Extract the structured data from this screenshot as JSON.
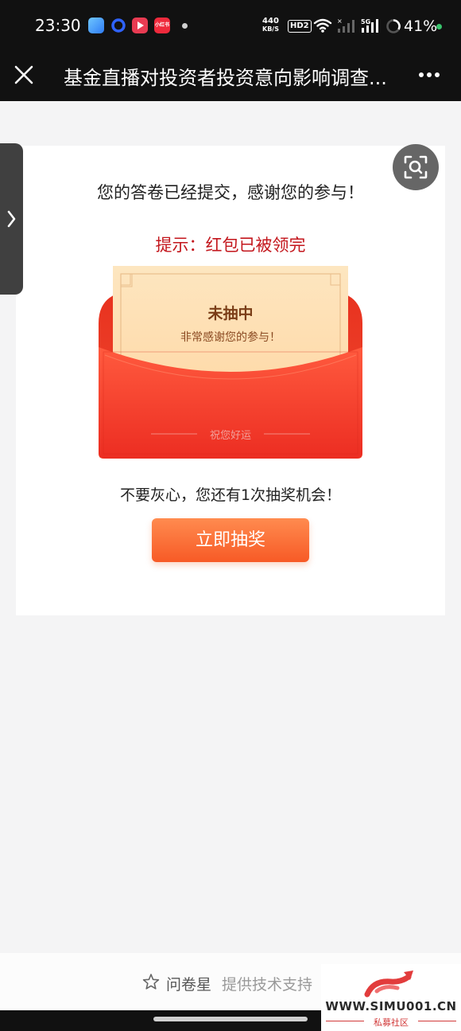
{
  "status_bar": {
    "time": "23:30",
    "net_speed_value": "440",
    "net_speed_unit": "KB/S",
    "hd_badge": "HD2",
    "network_type": "5G",
    "battery": "41%",
    "app_icons": [
      "notes-app-icon",
      "browser-app-icon",
      "video-app-icon",
      "xiaohongshu-app-icon"
    ],
    "xiaohongshu_label": "小红书"
  },
  "title_bar": {
    "title": "基金直播对投资者投资意向影响调查..."
  },
  "result": {
    "thanks": "您的答卷已经提交，感谢您的参与！",
    "hint": "提示：红包已被领完"
  },
  "envelope": {
    "title": "未抽中",
    "subtitle": "非常感谢您的参与！",
    "wish": "祝您好运"
  },
  "lottery": {
    "chance_text": "不要灰心，您还有1次抽奖机会！",
    "button_label": "立即抽奖"
  },
  "footer": {
    "brand": "问卷星",
    "support": "提供技术支持"
  },
  "watermark": {
    "site": "WWW.SIMU001.CN",
    "sub": "私募社区"
  },
  "colors": {
    "accent_red": "#c3161c",
    "button_orange": "#f75a26",
    "envelope_red": "#ee3a2c"
  }
}
